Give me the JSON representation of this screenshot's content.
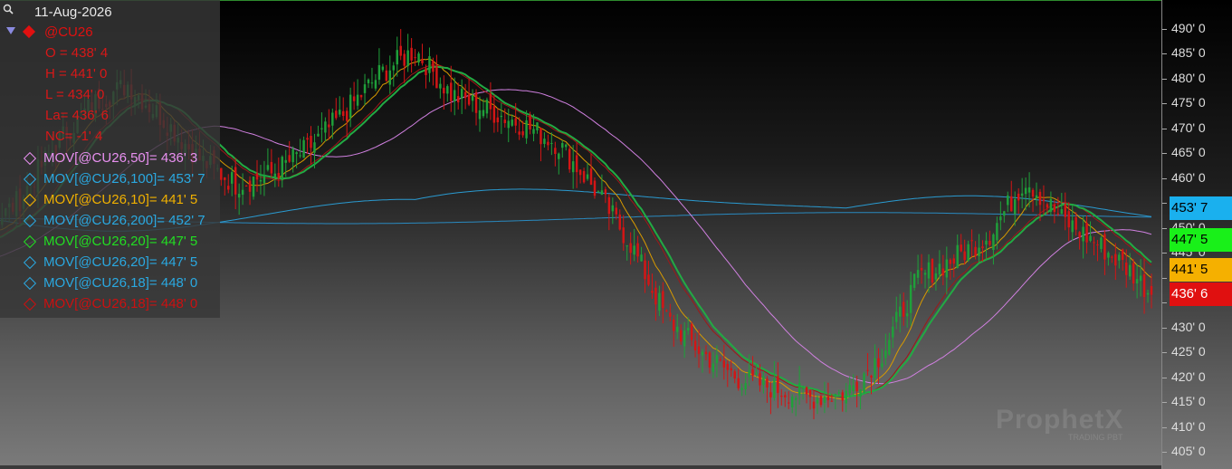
{
  "legend": {
    "date": "11-Aug-2026",
    "symbol": "@CU26",
    "ohlc": [
      {
        "text": "O = 438' 4"
      },
      {
        "text": "H = 441' 0"
      },
      {
        "text": "L = 434' 0"
      },
      {
        "text": "La= 436' 6"
      },
      {
        "text": "NC= -1' 4"
      }
    ],
    "studies": [
      {
        "text": "MOV[@CU26,50]= 436' 3",
        "color": "#e890f0"
      },
      {
        "text": "MOV[@CU26,100]= 453' 7",
        "color": "#2aa8e0"
      },
      {
        "text": "MOV[@CU26,10]= 441' 5",
        "color": "#f0b000"
      },
      {
        "text": "MOV[@CU26,200]= 452' 7",
        "color": "#2aa8e0"
      },
      {
        "text": "MOV[@CU26,20]= 447' 5",
        "color": "#22dd22"
      },
      {
        "text": "MOV[@CU26,20]= 447' 5",
        "color": "#2aa8e0"
      },
      {
        "text": "MOV[@CU26,18]= 448' 0",
        "color": "#2aa8e0"
      },
      {
        "text": "MOV[@CU26,18]= 448' 0",
        "color": "#cc1010"
      }
    ],
    "symbol_color": "#e01010"
  },
  "axis": {
    "ticks": [
      "490' 0",
      "485' 0",
      "480' 0",
      "475' 0",
      "470' 0",
      "465' 0",
      "460' 0",
      "455' 0",
      "450' 0",
      "445' 0",
      "440' 0",
      "435' 0",
      "430' 0",
      "425' 0",
      "420' 0",
      "415' 0",
      "410' 0",
      "405' 0"
    ],
    "tick_values": [
      490,
      485,
      480,
      475,
      470,
      465,
      460,
      455,
      450,
      445,
      440,
      435,
      430,
      425,
      420,
      415,
      410,
      405
    ],
    "badges": [
      {
        "text": "453' 7",
        "value": 453.875,
        "bg": "#1ab0ee",
        "fg": "#000000"
      },
      {
        "text": "447' 5",
        "value": 447.625,
        "bg": "#19f019",
        "fg": "#000000"
      },
      {
        "text": "441' 5",
        "value": 441.625,
        "bg": "#f5b000",
        "fg": "#000000"
      },
      {
        "text": "436' 6",
        "value": 436.75,
        "bg": "#e01010",
        "fg": "#ffffff"
      }
    ]
  },
  "watermark": {
    "brand": "ProphetX",
    "sub": "TRADING PBT"
  },
  "colors": {
    "up": "#1fa03a",
    "down": "#d41515",
    "ma10": "#d89a00",
    "ma20": "#22aa44",
    "ma18": "#a01818",
    "ma50": "#d080e0",
    "ma100": "#2a9ad0",
    "ma200": "#2a8ac0"
  },
  "chart_data": {
    "type": "candlestick",
    "symbol": "@CU26",
    "ylim": [
      403,
      494
    ],
    "anchors": [
      [
        0,
        452
      ],
      [
        10,
        448
      ],
      [
        20,
        444
      ],
      [
        30,
        441
      ],
      [
        40,
        440
      ],
      [
        50,
        442
      ],
      [
        60,
        444
      ],
      [
        70,
        447
      ],
      [
        80,
        449
      ],
      [
        90,
        456
      ],
      [
        100,
        467
      ],
      [
        110,
        475
      ],
      [
        120,
        479
      ],
      [
        130,
        472
      ],
      [
        140,
        464
      ],
      [
        150,
        459
      ],
      [
        160,
        461
      ],
      [
        170,
        466
      ],
      [
        180,
        473
      ],
      [
        190,
        481
      ],
      [
        200,
        486
      ],
      [
        210,
        477
      ],
      [
        220,
        474
      ],
      [
        230,
        471
      ],
      [
        240,
        467
      ],
      [
        250,
        458
      ],
      [
        260,
        447
      ],
      [
        270,
        432
      ],
      [
        280,
        425
      ],
      [
        290,
        420
      ],
      [
        300,
        418
      ],
      [
        310,
        416
      ],
      [
        320,
        417
      ],
      [
        330,
        425
      ],
      [
        340,
        440
      ],
      [
        350,
        444
      ],
      [
        360,
        449
      ],
      [
        370,
        460
      ],
      [
        380,
        452
      ],
      [
        390,
        447
      ],
      [
        400,
        441
      ],
      [
        405,
        436.75
      ]
    ],
    "ma10_last": 441.625,
    "ma20_last": 447.625,
    "ma18_last": 448.0,
    "ma50_last": 436.375,
    "ma100_last": 453.875,
    "ma200_last": 452.875,
    "last": {
      "open": 438.5,
      "high": 441.0,
      "low": 434.0,
      "last": 436.75,
      "net_change": -1.5
    }
  }
}
